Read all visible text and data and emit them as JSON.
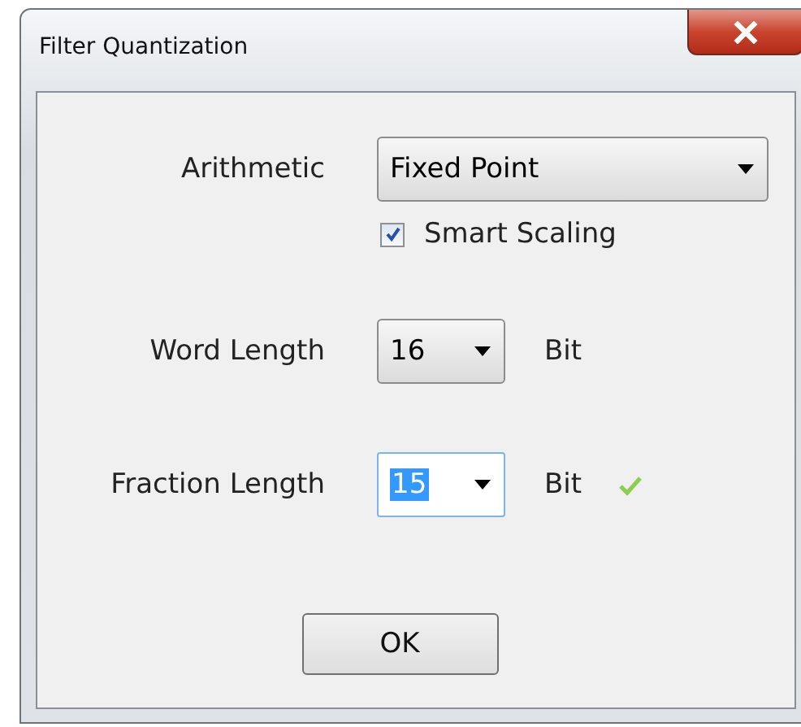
{
  "window": {
    "title": "Filter Quantization"
  },
  "arithmetic": {
    "label": "Arithmetic",
    "value": "Fixed Point"
  },
  "smart_scaling": {
    "label": "Smart Scaling",
    "checked": true
  },
  "word_length": {
    "label": "Word Length",
    "value": "16",
    "unit": "Bit"
  },
  "fraction_length": {
    "label": "Fraction Length",
    "value": "15",
    "unit": "Bit",
    "focused": true,
    "text_selected": true,
    "valid": true
  },
  "buttons": [
    "OK"
  ]
}
